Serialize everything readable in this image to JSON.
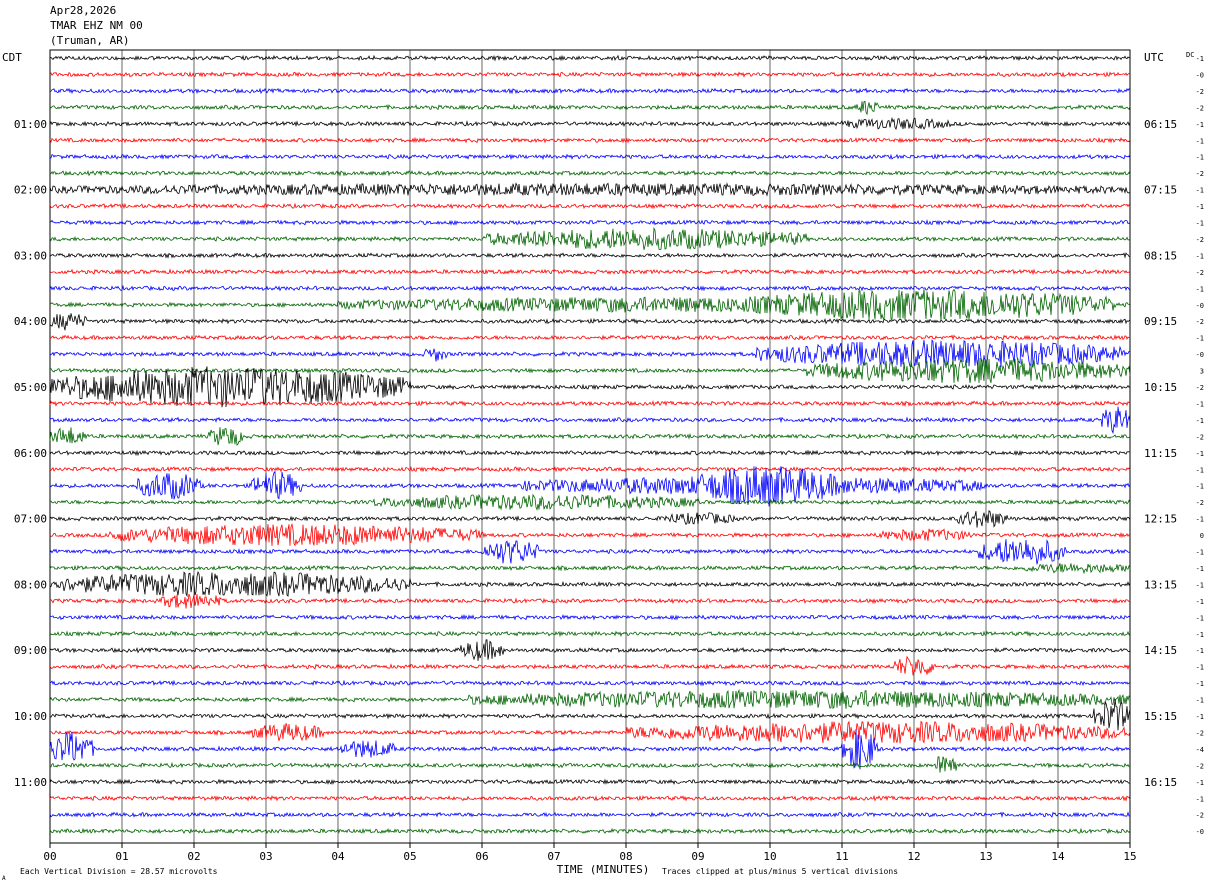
{
  "header": {
    "date": "Apr28,2026",
    "station": "TMAR EHZ NM 00",
    "location": "(Truman, AR)"
  },
  "left_label": "CDT",
  "right_label": "UTC",
  "dc_label": "DC",
  "footer": {
    "left_note": "Each Vertical Division =   28.57 microvolts",
    "x_title": "TIME (MINUTES)",
    "right_note": "Traces clipped at plus/minus 5 vertical divisions",
    "corner_mark": "A"
  },
  "colors": {
    "black": "#000000",
    "red": "#ff0000",
    "blue": "#0000ff",
    "green": "#006400"
  },
  "chart_data": {
    "type": "line",
    "title": "TMAR EHZ NM 00 (Truman, AR) Apr28,2026",
    "xlabel": "TIME (MINUTES)",
    "xlim": [
      0,
      15
    ],
    "x_ticks": [
      "00",
      "01",
      "02",
      "03",
      "04",
      "05",
      "06",
      "07",
      "08",
      "09",
      "10",
      "11",
      "12",
      "13",
      "14",
      "15"
    ],
    "trace_count": 48,
    "minutes_per_trace": 15,
    "trace_color_cycle": [
      "black",
      "red",
      "blue",
      "green"
    ],
    "left_hour_labels": [
      {
        "trace": 4,
        "label": "01:00"
      },
      {
        "trace": 8,
        "label": "02:00"
      },
      {
        "trace": 12,
        "label": "03:00"
      },
      {
        "trace": 16,
        "label": "04:00"
      },
      {
        "trace": 20,
        "label": "05:00"
      },
      {
        "trace": 24,
        "label": "06:00"
      },
      {
        "trace": 28,
        "label": "07:00"
      },
      {
        "trace": 32,
        "label": "08:00"
      },
      {
        "trace": 36,
        "label": "09:00"
      },
      {
        "trace": 40,
        "label": "10:00"
      },
      {
        "trace": 44,
        "label": "11:00"
      }
    ],
    "right_hour_labels": [
      {
        "trace": 4,
        "label": "06:15"
      },
      {
        "trace": 8,
        "label": "07:15"
      },
      {
        "trace": 12,
        "label": "08:15"
      },
      {
        "trace": 16,
        "label": "09:15"
      },
      {
        "trace": 20,
        "label": "10:15"
      },
      {
        "trace": 24,
        "label": "11:15"
      },
      {
        "trace": 28,
        "label": "12:15"
      },
      {
        "trace": 32,
        "label": "13:15"
      },
      {
        "trace": 36,
        "label": "14:15"
      },
      {
        "trace": 40,
        "label": "15:15"
      },
      {
        "trace": 44,
        "label": "16:15"
      }
    ],
    "dc_offsets": [
      "-1",
      "-0",
      "-2",
      "-2",
      "-1",
      "-1",
      "-1",
      "-2",
      "-1",
      "-1",
      "-1",
      "-2",
      "-1",
      "-2",
      "-1",
      "-0",
      "-2",
      "-1",
      "-0",
      "3",
      "-2",
      "-1",
      "-1",
      "-2",
      "-1",
      "-1",
      "-1",
      "-2",
      "-1",
      "0",
      "-1",
      "-1",
      "-1",
      "-1",
      "-1",
      "-1",
      "-1",
      "-1",
      "-1",
      "-1",
      "-1",
      "-2",
      "-4",
      "-2",
      "-1",
      "-1",
      "-2",
      "-0"
    ],
    "events": [
      {
        "trace": 3,
        "start": 11.2,
        "end": 11.5,
        "amp": 2.0
      },
      {
        "trace": 4,
        "start": 11.0,
        "end": 12.5,
        "amp": 1.4
      },
      {
        "trace": 8,
        "start": 0.0,
        "end": 15.0,
        "amp": 1.5
      },
      {
        "trace": 15,
        "start": 4.0,
        "end": 13.0,
        "amp": 2.0
      },
      {
        "trace": 11,
        "start": 6.0,
        "end": 10.5,
        "amp": 3.0
      },
      {
        "trace": 15,
        "start": 9.5,
        "end": 14.8,
        "amp": 4.5
      },
      {
        "trace": 16,
        "start": 0.0,
        "end": 0.5,
        "amp": 2.5
      },
      {
        "trace": 18,
        "start": 9.8,
        "end": 15.0,
        "amp": 4.0
      },
      {
        "trace": 19,
        "start": 10.5,
        "end": 15.0,
        "amp": 3.5
      },
      {
        "trace": 18,
        "start": 5.2,
        "end": 5.5,
        "amp": 2.0
      },
      {
        "trace": 20,
        "start": 0.0,
        "end": 5.0,
        "amp": 6.0
      },
      {
        "trace": 22,
        "start": 14.6,
        "end": 15.0,
        "amp": 4.0
      },
      {
        "trace": 23,
        "start": 0.0,
        "end": 0.5,
        "amp": 2.5
      },
      {
        "trace": 23,
        "start": 2.2,
        "end": 2.7,
        "amp": 3.0
      },
      {
        "trace": 26,
        "start": 1.2,
        "end": 2.1,
        "amp": 4.0
      },
      {
        "trace": 26,
        "start": 2.8,
        "end": 3.5,
        "amp": 4.0
      },
      {
        "trace": 26,
        "start": 6.5,
        "end": 13.0,
        "amp": 2.5
      },
      {
        "trace": 26,
        "start": 8.9,
        "end": 11.0,
        "amp": 6.0
      },
      {
        "trace": 27,
        "start": 4.5,
        "end": 9.0,
        "amp": 2.0
      },
      {
        "trace": 28,
        "start": 8.5,
        "end": 9.5,
        "amp": 1.5
      },
      {
        "trace": 28,
        "start": 12.6,
        "end": 13.3,
        "amp": 2.5
      },
      {
        "trace": 29,
        "start": 0.8,
        "end": 6.0,
        "amp": 3.0
      },
      {
        "trace": 29,
        "start": 11.5,
        "end": 12.8,
        "amp": 1.5
      },
      {
        "trace": 30,
        "start": 6.0,
        "end": 6.8,
        "amp": 3.5
      },
      {
        "trace": 30,
        "start": 12.9,
        "end": 14.1,
        "amp": 4.0
      },
      {
        "trace": 31,
        "start": 13.5,
        "end": 15.0,
        "amp": 1.2
      },
      {
        "trace": 32,
        "start": 0.0,
        "end": 5.0,
        "amp": 3.5
      },
      {
        "trace": 33,
        "start": 1.5,
        "end": 2.4,
        "amp": 2.0
      },
      {
        "trace": 36,
        "start": 5.7,
        "end": 6.3,
        "amp": 3.0
      },
      {
        "trace": 37,
        "start": 11.7,
        "end": 12.3,
        "amp": 3.0
      },
      {
        "trace": 39,
        "start": 5.8,
        "end": 15.0,
        "amp": 2.5
      },
      {
        "trace": 40,
        "start": 14.5,
        "end": 15.0,
        "amp": 5.0
      },
      {
        "trace": 41,
        "start": 2.8,
        "end": 3.8,
        "amp": 2.5
      },
      {
        "trace": 41,
        "start": 8.0,
        "end": 15.0,
        "amp": 3.0
      },
      {
        "trace": 42,
        "start": 0.0,
        "end": 0.6,
        "amp": 5.0
      },
      {
        "trace": 42,
        "start": 4.0,
        "end": 4.8,
        "amp": 2.5
      },
      {
        "trace": 42,
        "start": 11.0,
        "end": 11.5,
        "amp": 6.0
      },
      {
        "trace": 43,
        "start": 12.3,
        "end": 12.6,
        "amp": 4.0
      }
    ]
  }
}
